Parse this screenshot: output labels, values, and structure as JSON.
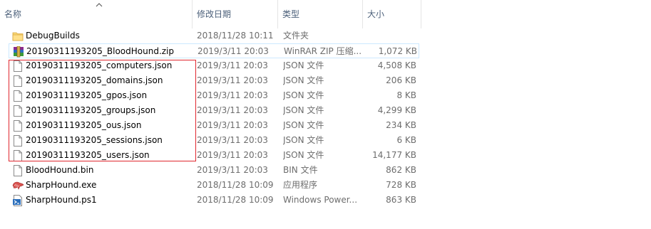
{
  "columns": {
    "name": "名称",
    "date": "修改日期",
    "type": "类型",
    "size": "大小"
  },
  "files": [
    {
      "name": "DebugBuilds",
      "date": "2018/11/28 10:11",
      "type": "文件夹",
      "size": "",
      "icon": "folder-icon"
    },
    {
      "name": "20190311193205_BloodHound.zip",
      "date": "2019/3/11 20:03",
      "type": "WinRAR ZIP 压缩...",
      "size": "1,072 KB",
      "icon": "winrar-icon"
    },
    {
      "name": "20190311193205_computers.json",
      "date": "2019/3/11 20:03",
      "type": "JSON 文件",
      "size": "4,508 KB",
      "icon": "file-icon"
    },
    {
      "name": "20190311193205_domains.json",
      "date": "2019/3/11 20:03",
      "type": "JSON 文件",
      "size": "206 KB",
      "icon": "file-icon"
    },
    {
      "name": "20190311193205_gpos.json",
      "date": "2019/3/11 20:03",
      "type": "JSON 文件",
      "size": "8 KB",
      "icon": "file-icon"
    },
    {
      "name": "20190311193205_groups.json",
      "date": "2019/3/11 20:03",
      "type": "JSON 文件",
      "size": "4,299 KB",
      "icon": "file-icon"
    },
    {
      "name": "20190311193205_ous.json",
      "date": "2019/3/11 20:03",
      "type": "JSON 文件",
      "size": "234 KB",
      "icon": "file-icon"
    },
    {
      "name": "20190311193205_sessions.json",
      "date": "2019/3/11 20:03",
      "type": "JSON 文件",
      "size": "6 KB",
      "icon": "file-icon"
    },
    {
      "name": "20190311193205_users.json",
      "date": "2019/3/11 20:03",
      "type": "JSON 文件",
      "size": "14,177 KB",
      "icon": "file-icon"
    },
    {
      "name": "BloodHound.bin",
      "date": "2019/3/11 20:03",
      "type": "BIN 文件",
      "size": "862 KB",
      "icon": "file-icon"
    },
    {
      "name": "SharpHound.exe",
      "date": "2018/11/28 10:09",
      "type": "应用程序",
      "size": "728 KB",
      "icon": "exe-icon"
    },
    {
      "name": "SharpHound.ps1",
      "date": "2018/11/28 10:09",
      "type": "Windows Power...",
      "size": "863 KB",
      "icon": "powershell-script-icon"
    }
  ],
  "colors": {
    "header_text": "#4c607a",
    "highlight_box": "#e0272f",
    "hover_border": "#cce8ff"
  }
}
